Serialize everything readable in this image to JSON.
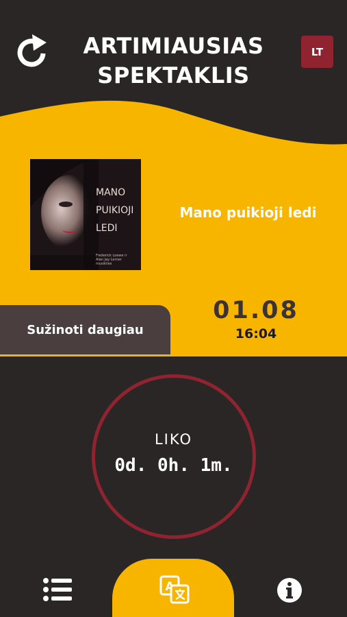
{
  "header": {
    "title_line1": "ARTIMIAUSIAS",
    "title_line2": "SPEKTAKLIS",
    "language_button": "LT",
    "refresh_icon": "refresh-icon"
  },
  "show": {
    "title": "Mano puikioji ledi",
    "poster_text": [
      "MANO",
      "PUIKIOJI",
      "LEDI"
    ],
    "poster_credits": [
      "Frederick Loewe ir",
      "Alan Jay Lerner",
      "musikiles"
    ],
    "more_button": "Sužinoti daugiau",
    "date": "01.08",
    "time": "16:04"
  },
  "countdown": {
    "label": "LIKO",
    "value": "0d. 0h. 1m."
  },
  "nav": {
    "left_icon": "list-icon",
    "center_icon": "translate-icon",
    "right_icon": "info-icon"
  },
  "colors": {
    "background": "#2b2626",
    "accent_yellow": "#f7b500",
    "accent_red": "#8f2430",
    "button_brown": "#4a3e3e"
  }
}
